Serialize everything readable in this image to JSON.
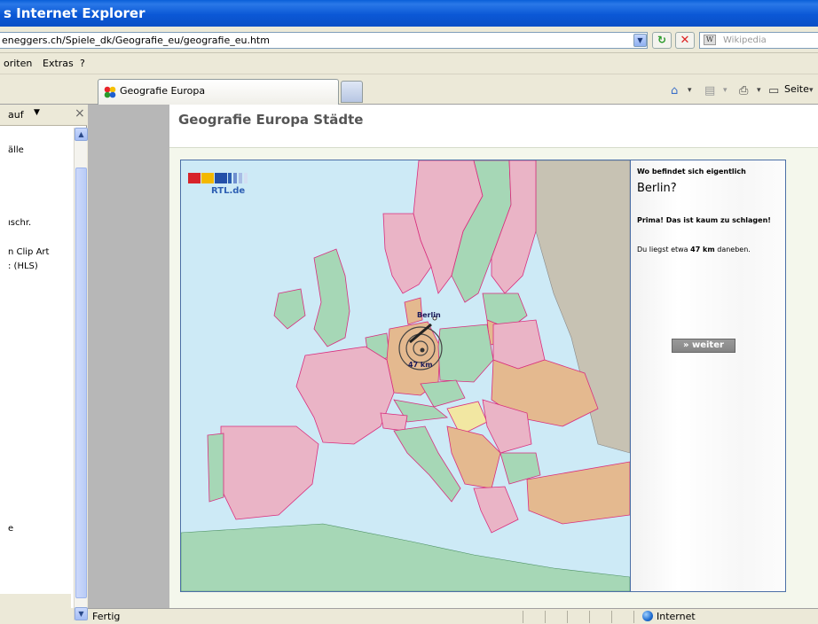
{
  "window": {
    "title": "s Internet Explorer"
  },
  "address_bar": {
    "url": "eneggers.ch/Spiele_dk/Geografie_eu/geografie_eu.htm",
    "search_placeholder": "Wikipedia"
  },
  "menu": {
    "items": [
      "oriten",
      "Extras",
      "?"
    ]
  },
  "tabs": {
    "active_label": "Geografie Europa"
  },
  "toolbar": {
    "page_label": "Seite"
  },
  "left_panel": {
    "header": "auf",
    "items": [
      "älle",
      "ıschr.",
      "n Clip Art",
      ": (HLS)",
      "e"
    ]
  },
  "page": {
    "title": "Geografie Europa Städte",
    "logo_text": "RTL.de",
    "question": "Wo befindet sich eigentlich",
    "city": "Berlin?",
    "praise": "Prima! Das ist kaum zu schlagen!",
    "distance_prefix": "Du liegst etwa",
    "distance_value": "47 km",
    "distance_suffix": "daneben.",
    "map_city_label": "Berlin",
    "map_distance_label": "47 km",
    "next_button": "» weiter"
  },
  "statusbar": {
    "text": "Fertig",
    "zone": "Internet"
  },
  "colors": {
    "titlebar": "#0b58d6",
    "sea": "#cdeaf6",
    "country_pink": "#eab4c6",
    "country_orange": "#e4b98f",
    "country_green": "#a6d7b6",
    "country_yellow": "#f2e7a2",
    "border": "#d92d7d"
  }
}
